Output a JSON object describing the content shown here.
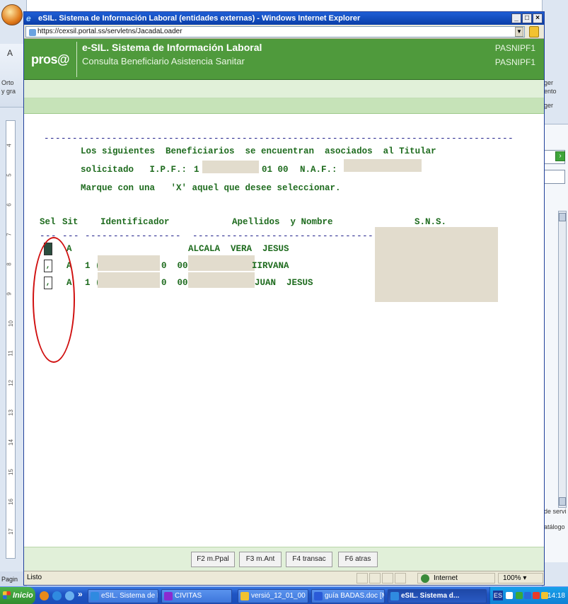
{
  "window": {
    "title": "eSIL. Sistema de Información Laboral (entidades externas) - Windows Internet Explorer",
    "url": "https://cexsil.portal.ss/servletns/JacadaLoader"
  },
  "app": {
    "logo_text": "pros@",
    "title": "e-SIL. Sistema de Información Laboral",
    "subtitle": "Consulta Beneficiario Asistencia Sanitar",
    "code1": "PASNIPF1",
    "code2": "PASNIPF1"
  },
  "terminal": {
    "intro1": "Los siguientes  Beneficiarios  se encuentran  asociados  al Titular",
    "intro2_label": "solicitado   I.P.F.:",
    "ipf_prefix": "1",
    "ipf_suffix": "01 00",
    "naf_label": "N.A.F.:",
    "intro3": "Marque con una   'X' aquel que desee seleccionar.",
    "col_sel": "Sel",
    "col_sit": "Sit",
    "col_identificador": "Identificador",
    "col_apellidos": "Apellidos  y Nombre",
    "col_sns": "S.N.S.",
    "rows": [
      {
        "sel": "",
        "sit": "A",
        "id_prefix": "",
        "id_suffix": "",
        "name": "ALCALA  VERA  JESUS"
      },
      {
        "sel": ",",
        "sit": "A",
        "id_prefix": "1 (",
        "id_suffix": "0  00",
        "name": "IIRVANA"
      },
      {
        "sel": ",",
        "sit": "A",
        "id_prefix": "1 (",
        "id_suffix": "0  00",
        "name": "JUAN  JESUS"
      }
    ]
  },
  "function_keys": [
    "F2 m.Ppal",
    "F3 m.Ant",
    "F4 transac",
    "F6 atras"
  ],
  "status": {
    "text": "Listo",
    "zone": "Internet",
    "zoom": "100%"
  },
  "taskbar": {
    "start_label": "Inicio",
    "tasks": [
      "eSIL. Sistema de Inf...",
      "CIVITAS",
      "versió_12_01_00",
      "guía BADAS.doc [M...",
      "eSIL. Sistema d..."
    ],
    "clock": "14:18",
    "lang": "ES"
  },
  "background": {
    "word_left": [
      "A",
      "Orto",
      "y gra",
      "Pagin"
    ],
    "word_right": [
      "ger",
      "ento",
      "ger",
      "de servi",
      "atálogo"
    ],
    "ruler_marks": [
      "4",
      "5",
      "6",
      "7",
      "8",
      "9",
      "10",
      "11",
      "12",
      "13",
      "14",
      "15",
      "16",
      "17"
    ]
  }
}
